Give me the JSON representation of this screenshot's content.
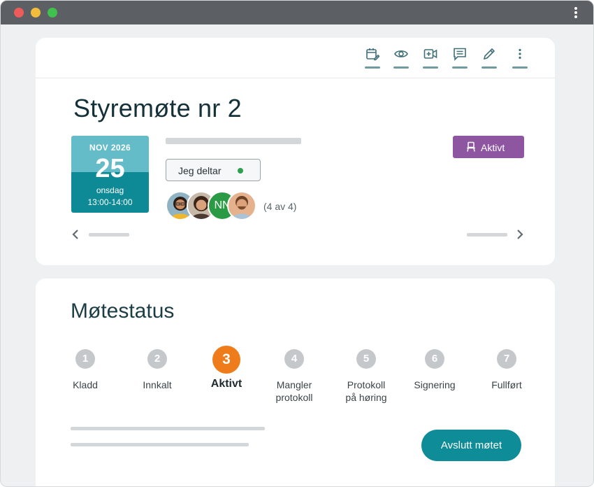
{
  "window": {
    "controls": [
      "close",
      "minimize",
      "maximize"
    ],
    "menu_icon": "kebab-icon"
  },
  "toolbar": {
    "icons": [
      "calendar-edit-icon",
      "eye-icon",
      "video-add-icon",
      "comment-icon",
      "pencil-icon",
      "more-vertical-icon"
    ]
  },
  "meeting": {
    "title": "Styremøte nr 2",
    "date": {
      "month_year": "NOV 2026",
      "day": "25",
      "weekday": "onsdag",
      "time": "13:00-14:00"
    },
    "attend_label": "Jeg deltar",
    "attend_status_color": "#2e9e4f",
    "participant_initials": "NN",
    "participant_count": "(4 av 4)",
    "status_label": "Aktivt",
    "status_color": "#8e55a0"
  },
  "meeting_status": {
    "title": "Møtestatus",
    "steps": [
      {
        "number": "1",
        "label": "Kladd"
      },
      {
        "number": "2",
        "label": "Innkalt"
      },
      {
        "number": "3",
        "label": "Aktivt"
      },
      {
        "number": "4",
        "label": "Mangler protokoll"
      },
      {
        "number": "5",
        "label": "Protokoll på høring"
      },
      {
        "number": "6",
        "label": "Signering"
      },
      {
        "number": "7",
        "label": "Fullført"
      }
    ],
    "active_step": 3,
    "active_color": "#ef7c1a",
    "action_label": "Avslutt møtet"
  }
}
